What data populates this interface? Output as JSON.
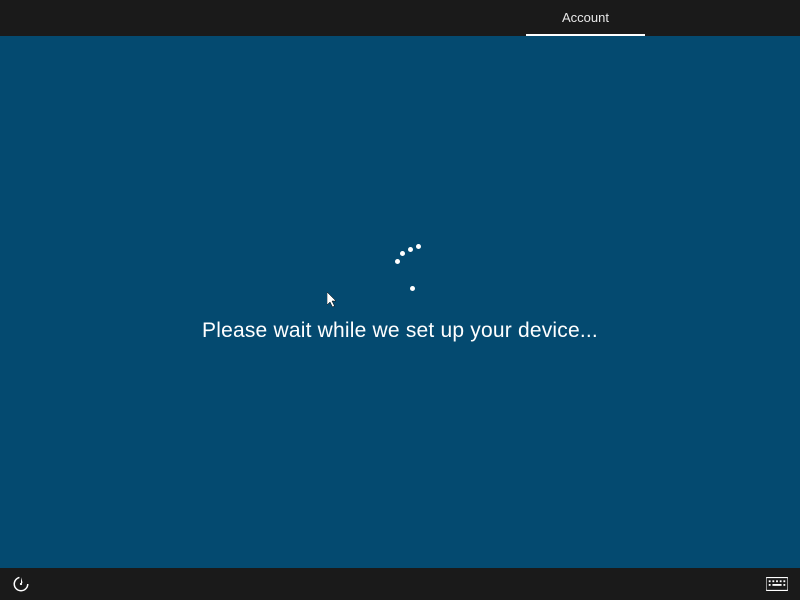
{
  "header": {
    "active_tab_label": "Account"
  },
  "main": {
    "status_text": "Please wait while we set up your device..."
  },
  "colors": {
    "top_bar_bg": "#1a1a1a",
    "main_bg": "#044a70",
    "bottom_bar_bg": "#1a1a1a",
    "text": "#ffffff"
  },
  "icons": {
    "ease_of_access": "ease-of-access-icon",
    "keyboard": "keyboard-icon"
  }
}
